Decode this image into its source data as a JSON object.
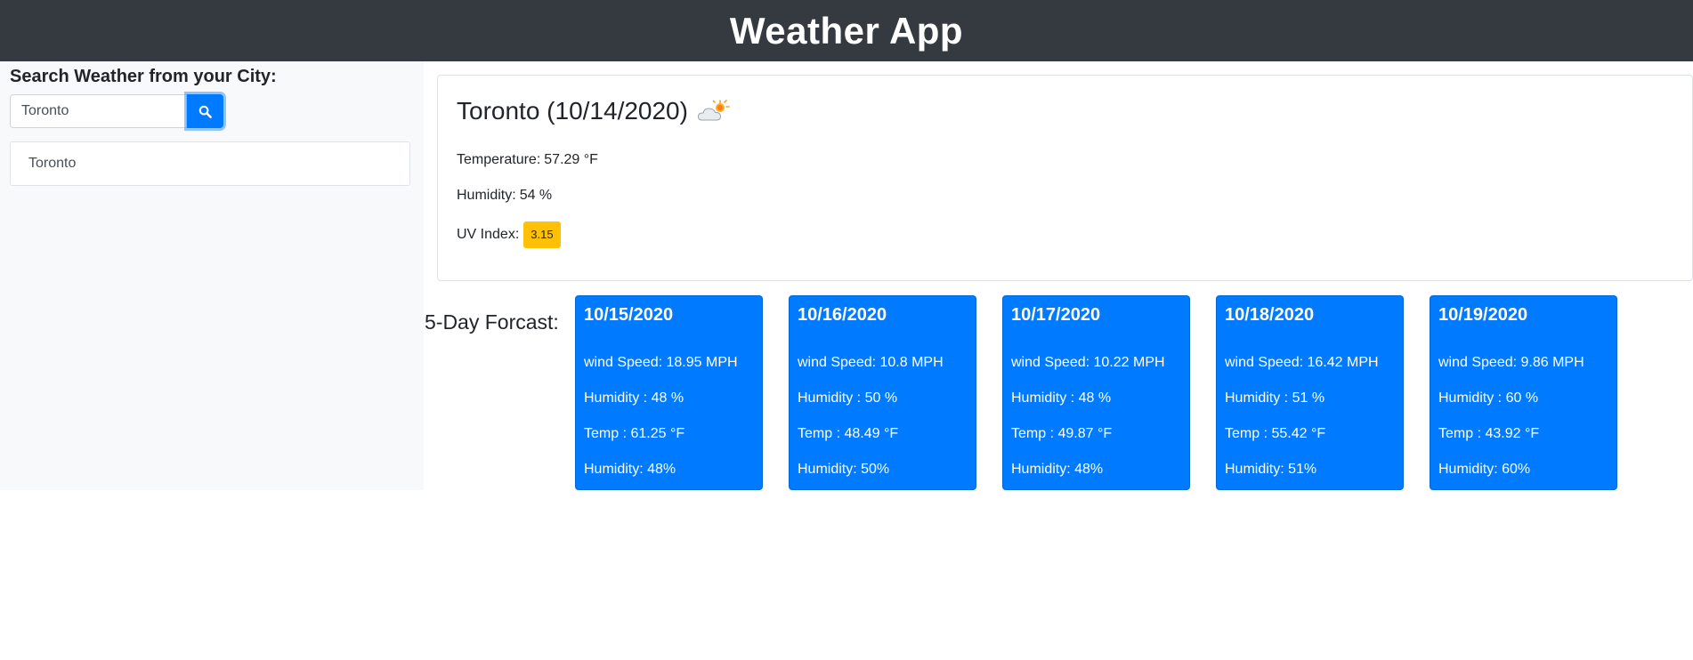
{
  "header": {
    "title": "Weather App"
  },
  "sidebar": {
    "search_label": "Search Weather from your City:",
    "search_value": "Toronto",
    "search_icon": "search-icon",
    "history": [
      "Toronto"
    ]
  },
  "current": {
    "city_date": "Toronto (10/14/2020)",
    "icon": "partly-cloudy-day-icon",
    "temperature_label": "Temperature:",
    "temperature": "57.29 °F",
    "humidity_label": "Humidity:",
    "humidity": "54 %",
    "uv_label": "UV Index:",
    "uv_value": "3.15"
  },
  "forecast": {
    "label": "5-Day Forcast:",
    "days": [
      {
        "date": "10/15/2020",
        "wind": "wind Speed: 18.95 MPH",
        "humidity_a": "Humidity : 48 %",
        "temp": "Temp : 61.25 °F",
        "humidity_b": "Humidity: 48%"
      },
      {
        "date": "10/16/2020",
        "wind": "wind Speed: 10.8 MPH",
        "humidity_a": "Humidity : 50 %",
        "temp": "Temp : 48.49 °F",
        "humidity_b": "Humidity: 50%"
      },
      {
        "date": "10/17/2020",
        "wind": "wind Speed: 10.22 MPH",
        "humidity_a": "Humidity : 48 %",
        "temp": "Temp : 49.87 °F",
        "humidity_b": "Humidity: 48%"
      },
      {
        "date": "10/18/2020",
        "wind": "wind Speed: 16.42 MPH",
        "humidity_a": "Humidity : 51 %",
        "temp": "Temp : 55.42 °F",
        "humidity_b": "Humidity: 51%"
      },
      {
        "date": "10/19/2020",
        "wind": "wind Speed: 9.86 MPH",
        "humidity_a": "Humidity : 60 %",
        "temp": "Temp : 43.92 °F",
        "humidity_b": "Humidity: 60%"
      }
    ]
  },
  "colors": {
    "header_bg": "#343a40",
    "primary": "#007bff",
    "uv_moderate": "#ffc107",
    "sidebar_bg": "#f8f9fa"
  }
}
